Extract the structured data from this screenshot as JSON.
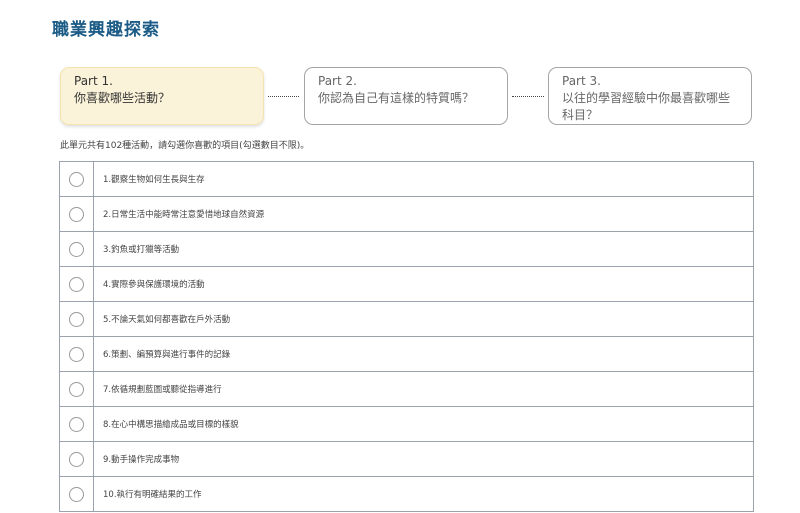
{
  "page": {
    "title": "職業興趣探索"
  },
  "steps": [
    {
      "part": "Part 1.",
      "question": "你喜歡哪些活動？"
    },
    {
      "part": "Part 2.",
      "question": "你認為自己有這樣的特質嗎？"
    },
    {
      "part": "Part 3.",
      "question": "以往的學習經驗中你最喜歡哪些科目？"
    }
  ],
  "instruction": "此單元共有102種活動，請勾選你喜歡的項目(勾選數目不限)。",
  "activities": [
    {
      "label": "1.觀察生物如何生長與生存",
      "checked": false
    },
    {
      "label": "2.日常生活中能時常注意愛惜地球自然資源",
      "checked": false
    },
    {
      "label": "3.釣魚或打獵等活動",
      "checked": false
    },
    {
      "label": "4.實際參與保護環境的活動",
      "checked": false
    },
    {
      "label": "5.不論天氣如何都喜歡在戶外活動",
      "checked": false
    },
    {
      "label": "6.策劃、編預算與進行事件的記錄",
      "checked": false
    },
    {
      "label": "7.依循規劃藍圖或聽從指導進行",
      "checked": false
    },
    {
      "label": "8.在心中構思描繪成品或目標的樣貌",
      "checked": false
    },
    {
      "label": "9.動手操作完成事物",
      "checked": false
    },
    {
      "label": "10.執行有明確結果的工作",
      "checked": false
    }
  ]
}
